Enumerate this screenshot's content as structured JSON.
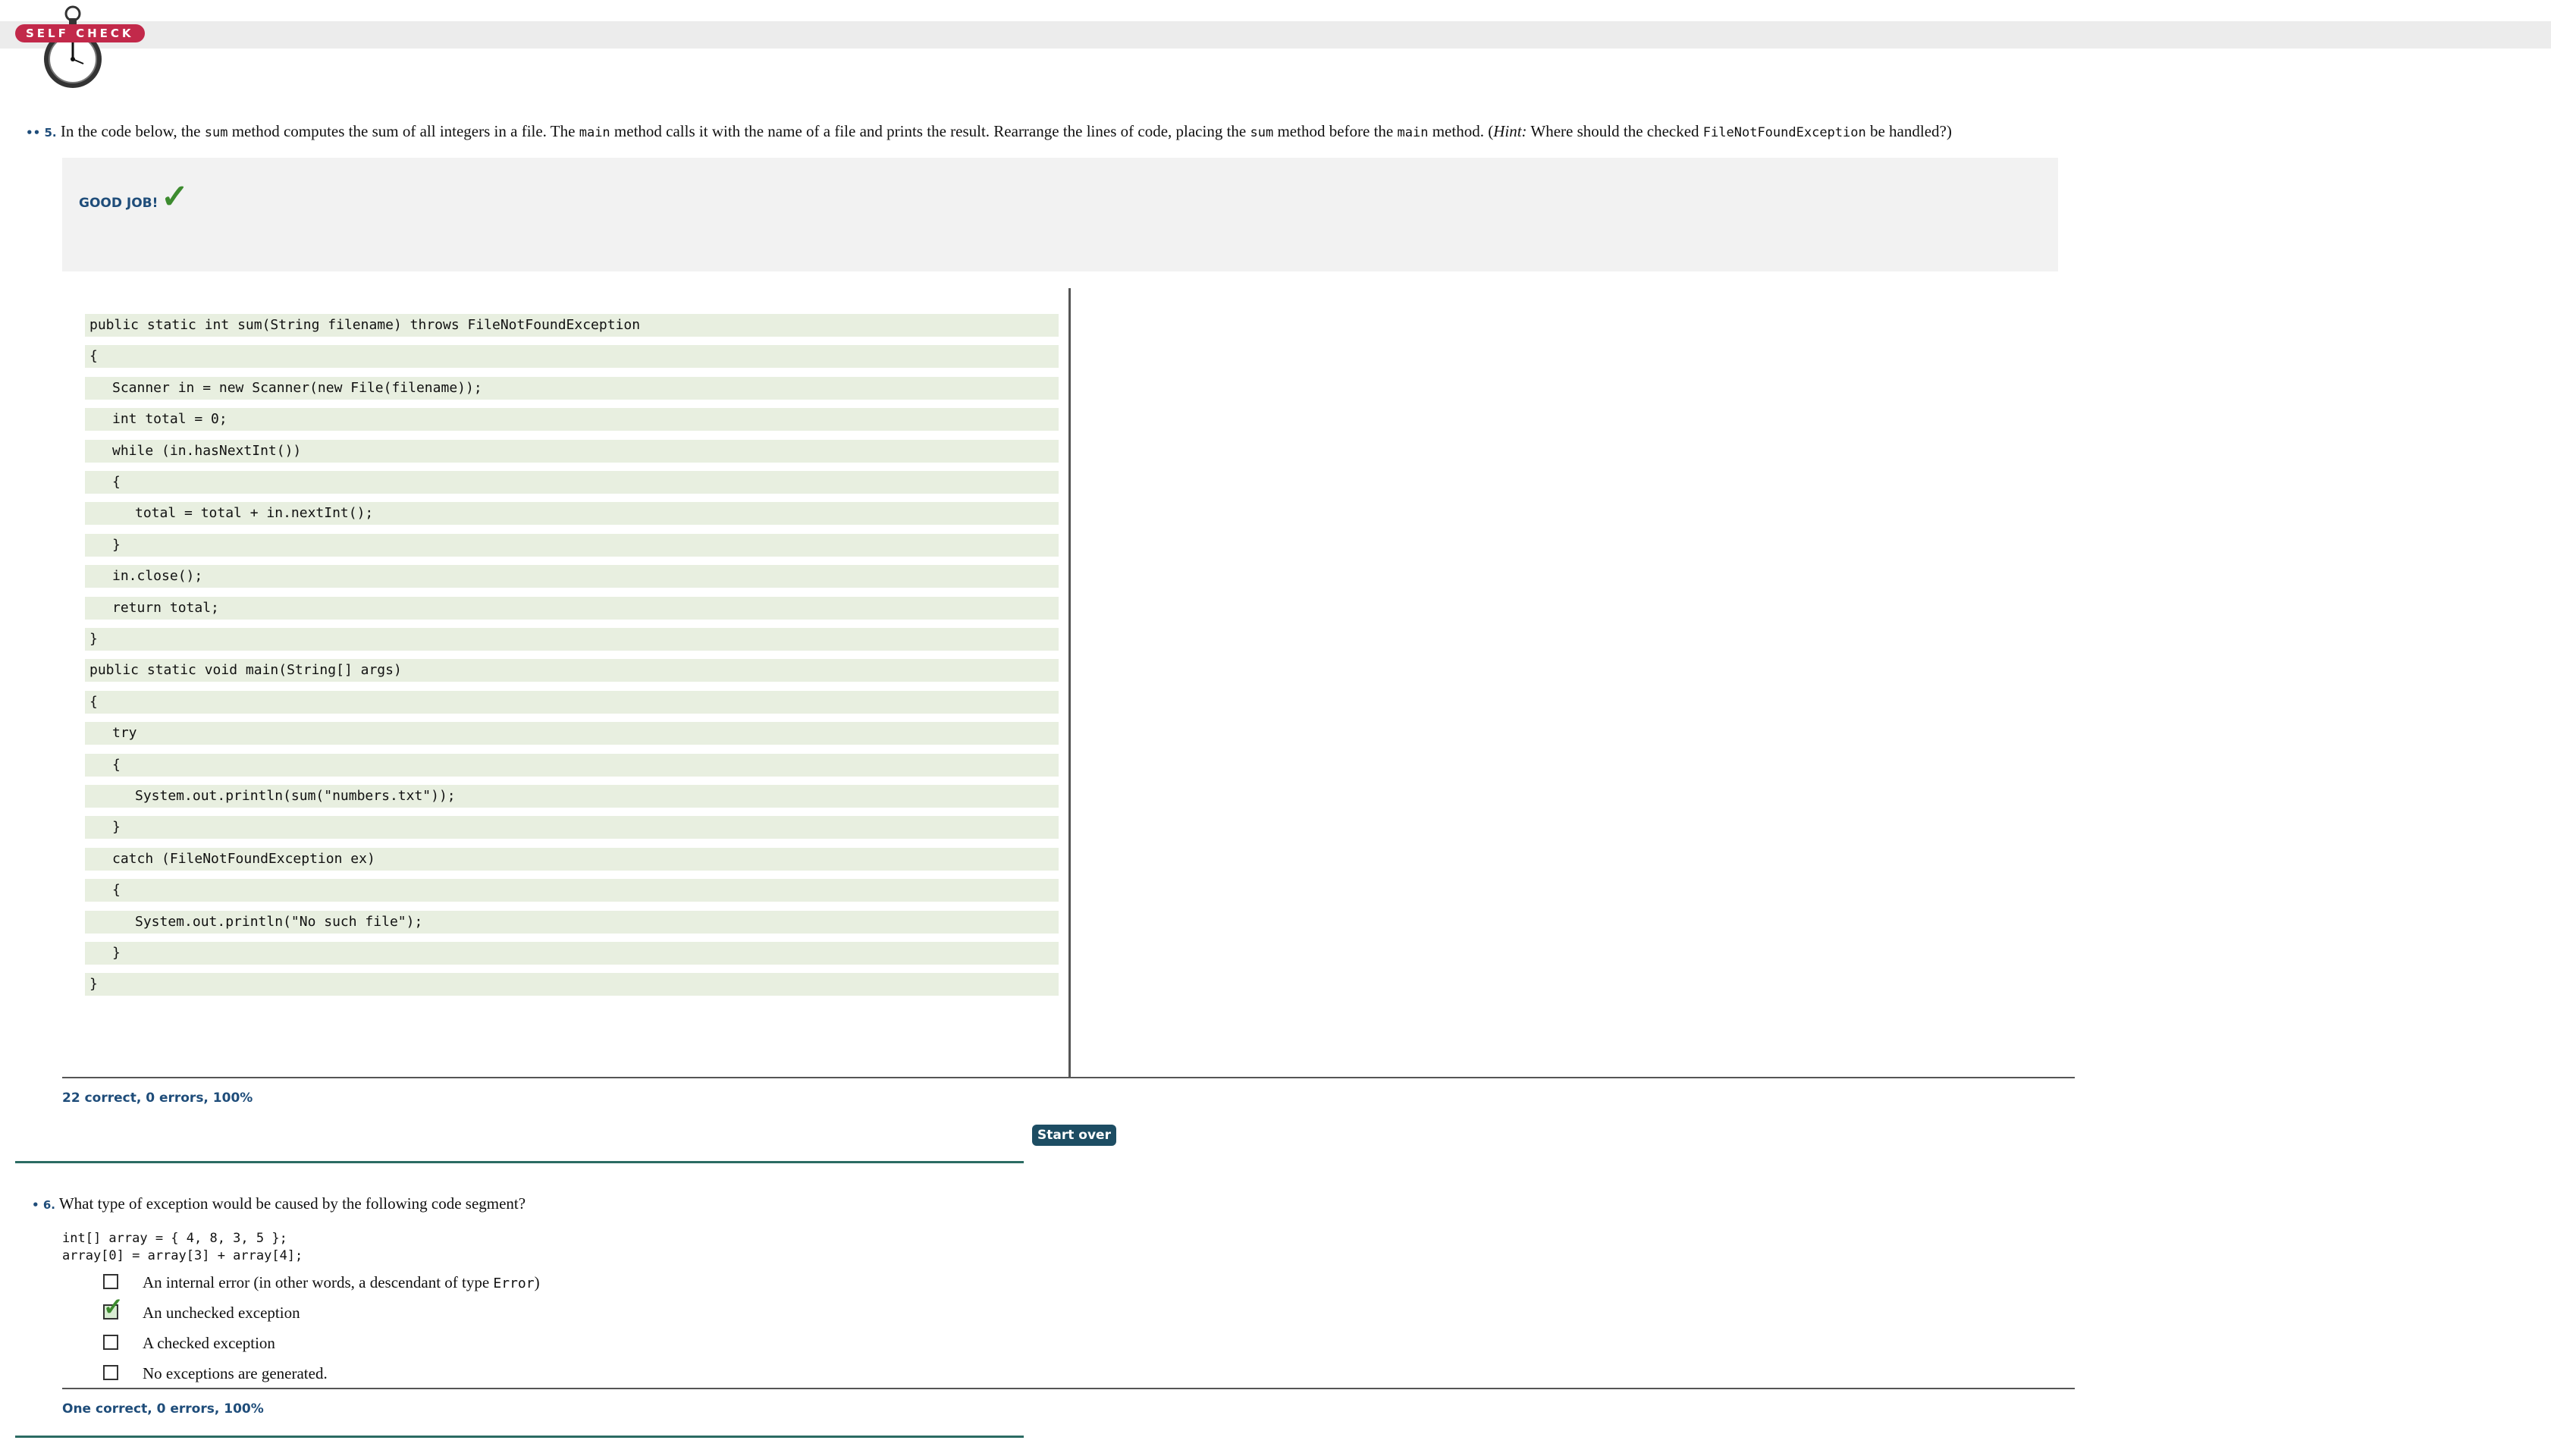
{
  "header": {
    "badge": "SELF CHECK"
  },
  "q5": {
    "bullets": "••",
    "number": "5.",
    "text_1": "In the code below, the",
    "code_sum": "sum",
    "text_2": "method computes the sum of all integers in a file. The",
    "code_main": "main",
    "text_3": "method calls it with the name of a file and prints the result. Rearrange the lines of code, placing the",
    "code_sum_2": "sum",
    "text_4": "method before the",
    "code_main_2": "main",
    "text_5": "method. (",
    "hint_label": "Hint:",
    "text_6": "Where should the checked",
    "code_exception": "FileNotFoundException",
    "text_7": "be handled?)",
    "feedback": "GOOD JOB!",
    "feedback_icon": "checkmark-icon",
    "code_lines": [
      {
        "indent": 0,
        "text": "public static int sum(String filename) throws FileNotFoundException"
      },
      {
        "indent": 0,
        "text": "{"
      },
      {
        "indent": 1,
        "text": "Scanner in = new Scanner(new File(filename));"
      },
      {
        "indent": 1,
        "text": "int total = 0;"
      },
      {
        "indent": 1,
        "text": "while (in.hasNextInt())"
      },
      {
        "indent": 1,
        "text": "{"
      },
      {
        "indent": 2,
        "text": "total = total + in.nextInt();"
      },
      {
        "indent": 1,
        "text": "}"
      },
      {
        "indent": 1,
        "text": "in.close();"
      },
      {
        "indent": 1,
        "text": "return total;"
      },
      {
        "indent": 0,
        "text": "}"
      },
      {
        "indent": 0,
        "text": "public static void main(String[] args)"
      },
      {
        "indent": 0,
        "text": "{"
      },
      {
        "indent": 1,
        "text": "try"
      },
      {
        "indent": 1,
        "text": "{"
      },
      {
        "indent": 2,
        "text": "System.out.println(sum(\"numbers.txt\"));"
      },
      {
        "indent": 1,
        "text": "}"
      },
      {
        "indent": 1,
        "text": "catch (FileNotFoundException ex)"
      },
      {
        "indent": 1,
        "text": "{"
      },
      {
        "indent": 2,
        "text": "System.out.println(\"No such file\");"
      },
      {
        "indent": 1,
        "text": "}"
      },
      {
        "indent": 0,
        "text": "}"
      }
    ],
    "score": "22 correct, 0 errors, 100%",
    "start_over": "Start over"
  },
  "q6": {
    "bullets": "•",
    "number": "6.",
    "text": "What type of exception would be caused by the following code segment?",
    "code": "int[] array = { 4, 8, 3, 5 };\narray[0] = array[3] + array[4];",
    "choices": [
      {
        "label": "An internal error (in other words, a descendant of type",
        "code": "Error",
        "suffix": ")",
        "checked": false
      },
      {
        "label": "An unchecked exception",
        "checked": true
      },
      {
        "label": "A checked exception",
        "checked": false
      },
      {
        "label": "No exceptions are generated.",
        "checked": false
      }
    ],
    "score": "One correct, 0 errors, 100%"
  },
  "colors": {
    "badge": "#c2294a",
    "accent_blue": "#1f4d7a",
    "code_block_bg": "#e8efe0",
    "button_bg": "#1d4d63",
    "check_green": "#3d8b2f",
    "rule_teal": "#2b6b63"
  }
}
